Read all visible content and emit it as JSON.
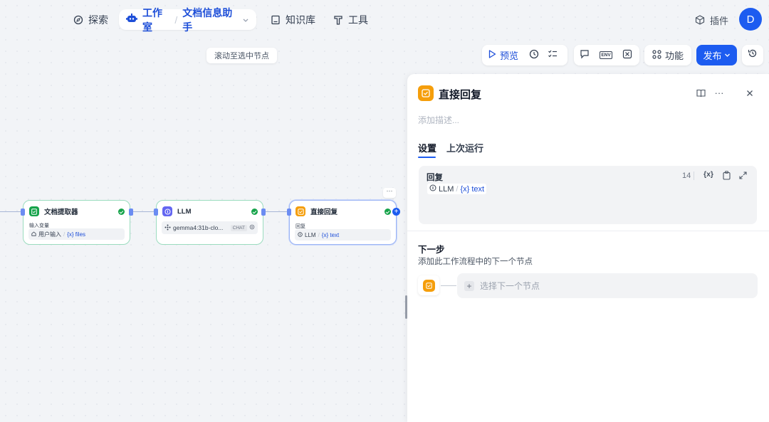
{
  "nav": {
    "explore_label": "探索",
    "studio_label": "工作室",
    "app_name": "文档信息助手",
    "knowledge_label": "知识库",
    "tools_label": "工具",
    "plugins_label": "插件",
    "avatar_initial": "D"
  },
  "toolbar": {
    "preview_label": "预览",
    "features_label": "功能",
    "publish_label": "发布",
    "env_label": "ENV"
  },
  "canvas": {
    "scroll_hint": "滚动至选中节点",
    "nodes": [
      {
        "title": "文档提取器",
        "sub_label": "输入变量",
        "source": "用户输入",
        "var": "{x} files",
        "icon_color": "#16a34a"
      },
      {
        "title": "LLM",
        "model": "gemma4:31b-clo...",
        "badge": "CHAT",
        "icon_color": "#6366f1"
      },
      {
        "title": "直接回复",
        "sub_label": "回复",
        "source": "LLM",
        "var": "{x} text",
        "icon_color": "#f59e0b"
      }
    ]
  },
  "panel": {
    "title": "直接回复",
    "description_placeholder": "添加描述...",
    "tabs": [
      "设置",
      "上次运行"
    ],
    "reply": {
      "label": "回复",
      "char_count": "14",
      "var_source": "LLM",
      "var_name": "{x} text",
      "var_button": "{x}"
    },
    "next_step": {
      "title": "下一步",
      "description": "添加此工作流程中的下一个节点",
      "select_placeholder": "选择下一个节点"
    }
  },
  "colors": {
    "accent": "#1d5cf0",
    "success": "#16a34a",
    "reply_orange": "#f59e0b"
  }
}
